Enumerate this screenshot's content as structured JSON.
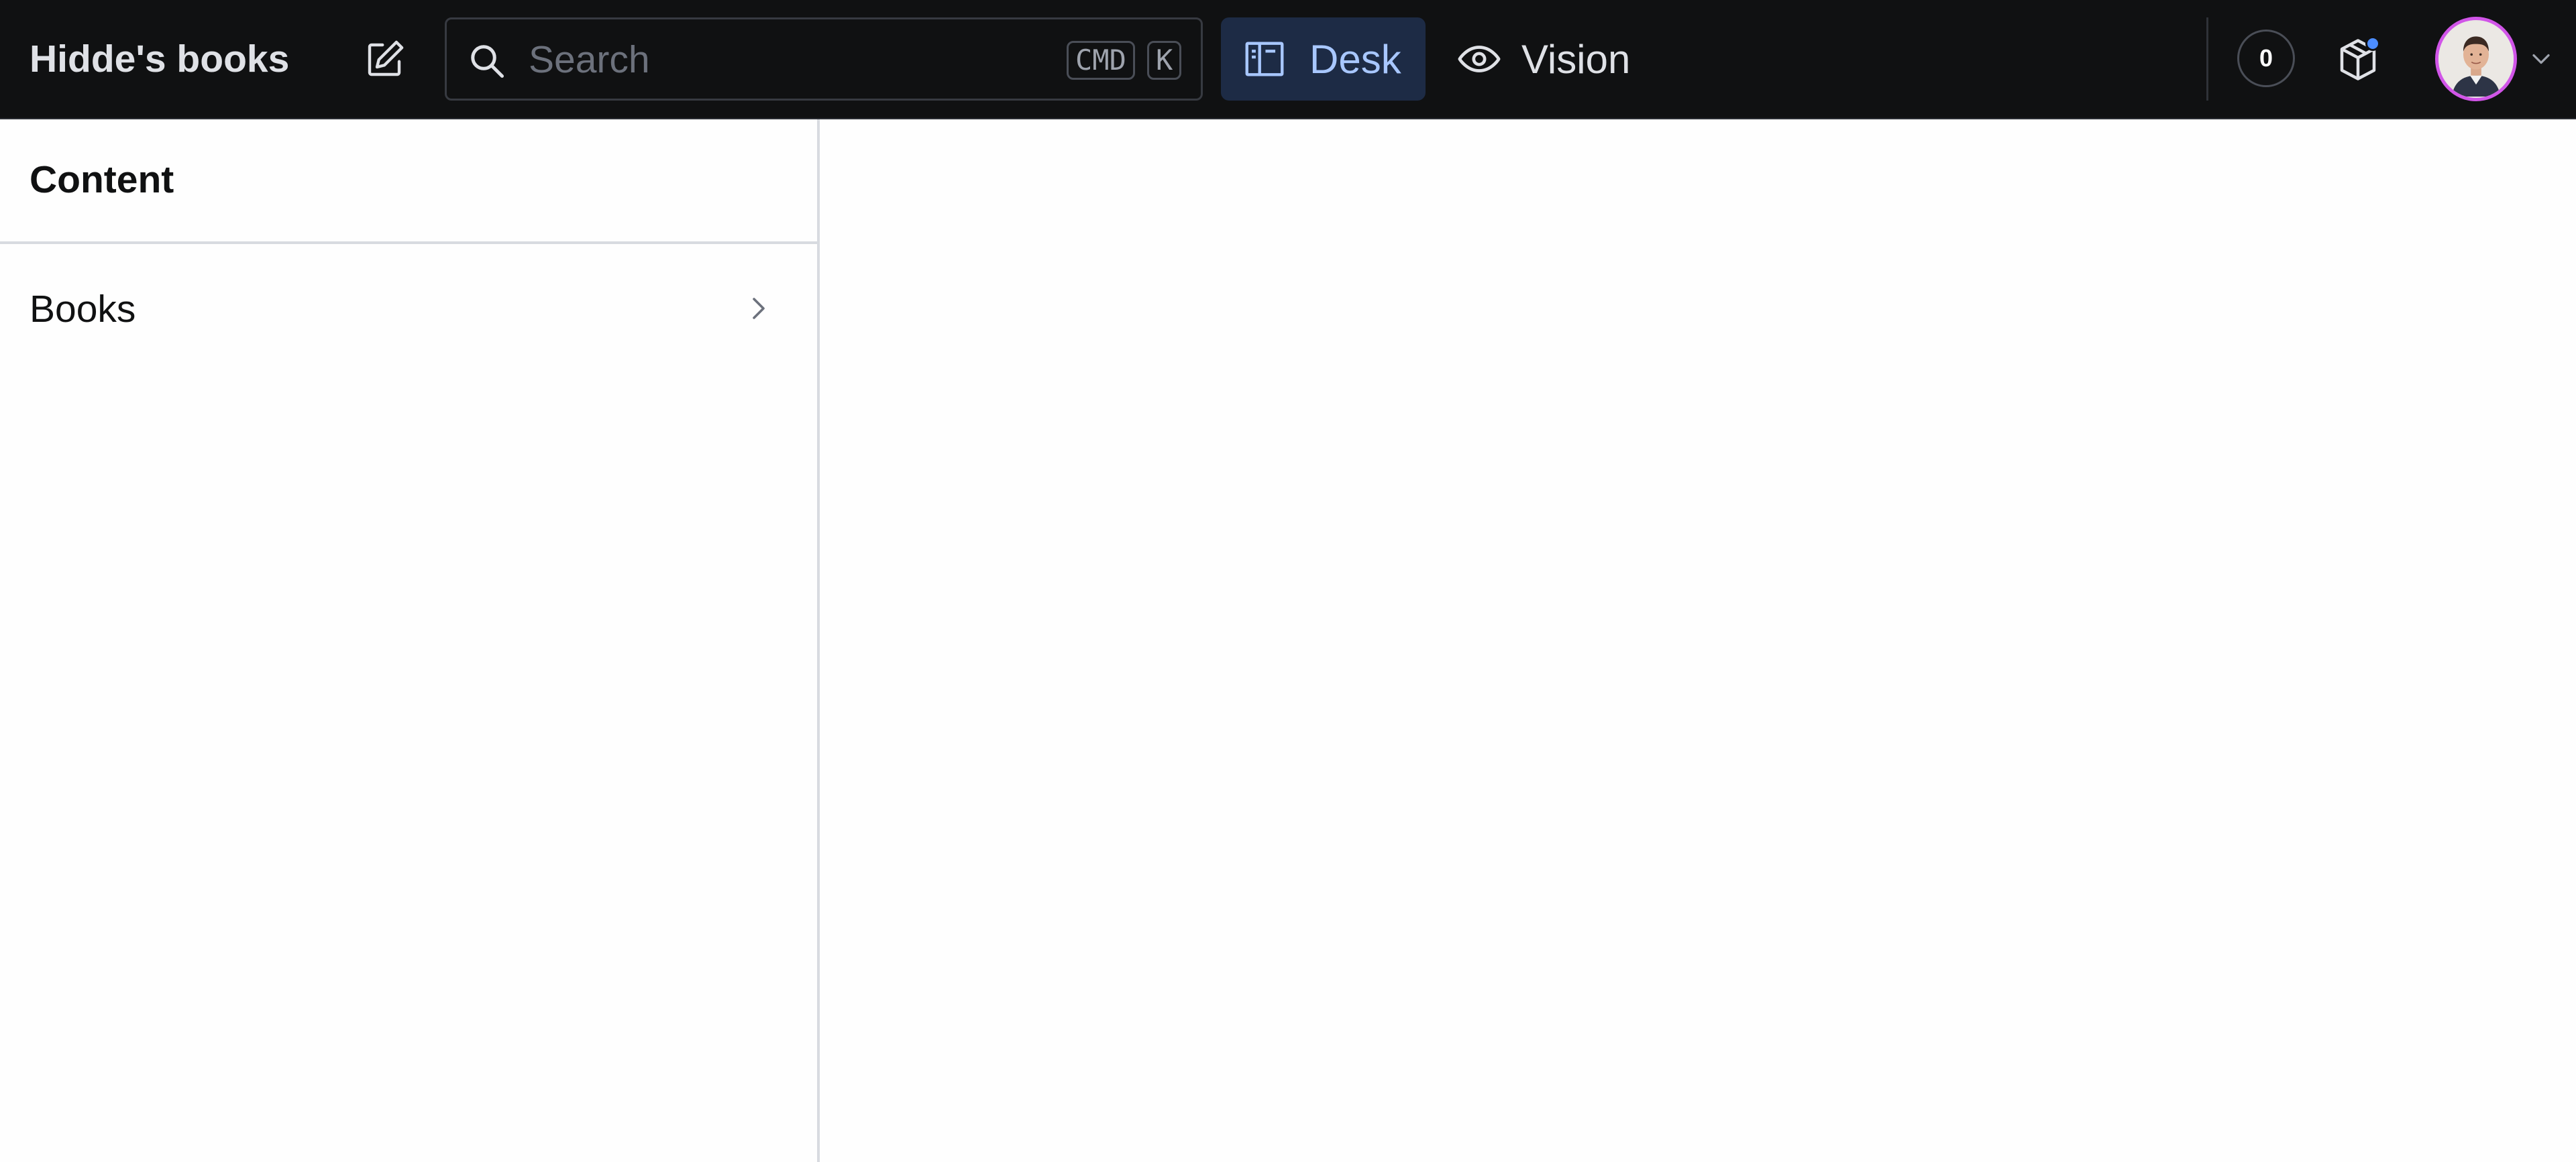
{
  "app": {
    "title": "Hidde's books"
  },
  "navbar": {
    "compose_icon": "compose-icon",
    "search": {
      "placeholder": "Search",
      "value": "",
      "shortcut_keys": [
        "CMD",
        "K"
      ]
    },
    "tools": [
      {
        "label": "Desk",
        "icon": "desk-icon",
        "active": true
      },
      {
        "label": "Vision",
        "icon": "eye-icon",
        "active": false
      }
    ],
    "counter": "0",
    "resources_icon": "package-icon",
    "avatar_icon": "user-avatar"
  },
  "pane": {
    "title": "Content",
    "items": [
      {
        "label": "Books",
        "icon": "chevron-right-icon"
      }
    ]
  },
  "colors": {
    "navbar_bg": "#101112",
    "active_tab_bg": "#1d2b45",
    "active_tab_text": "#a8c7ff",
    "avatar_ring": "#d155e8",
    "notification_dot": "#4c8dff"
  }
}
